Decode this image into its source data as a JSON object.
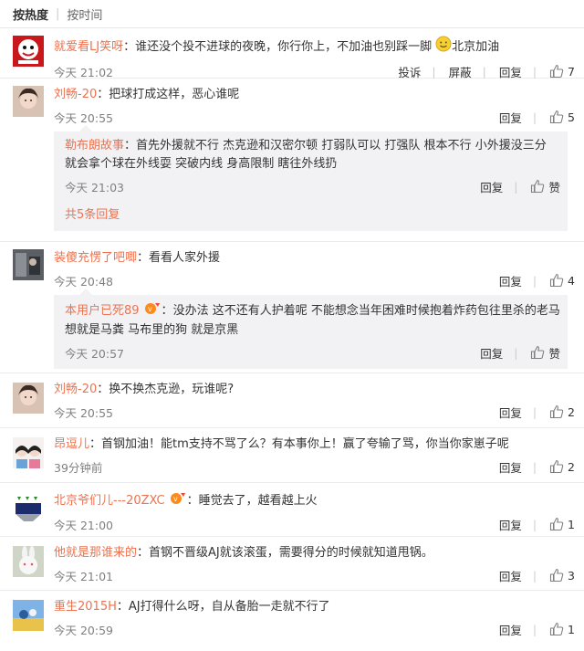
{
  "sort": {
    "hot": "按热度",
    "time": "按时间"
  },
  "actions": {
    "report": "投诉",
    "block": "屏蔽",
    "reply": "回复",
    "like_word": "赞"
  },
  "colors": {
    "username": "#eb7350",
    "bg_sub": "#f2f2f5"
  },
  "comments": [
    {
      "user": "就爱看LJ笑呀",
      "sep": "：",
      "text_before": "谁还没个投不进球的夜晚，你行你上，不加油也别踩一脚",
      "emoji": "smile-emoji",
      "text_after": "北京加油",
      "time": "今天 21:02",
      "likes": "7"
    },
    {
      "user": "刘畅-20",
      "sep": "：",
      "text": "把球打成这样，恶心谁呢",
      "time": "今天 20:55",
      "likes": "5",
      "reply": {
        "user": "勒布朗故事",
        "sep": "：",
        "text": "首先外援就不行 杰克逊和汉密尔顿 打弱队可以 打强队 根本不行 小外援没三分 就会拿个球在外线耍 突破内线 身高限制 瞎往外线扔",
        "time": "今天 21:03"
      },
      "more": "共5条回复"
    },
    {
      "user": "装傻充愣了吧唧",
      "sep": "：",
      "text": "看看人家外援",
      "time": "今天 20:48",
      "likes": "4",
      "reply": {
        "user": "本用户已死89",
        "sep": "：",
        "text": "没办法 这不还有人护着呢 不能想念当年困难时候抱着炸药包往里杀的老马 想就是马粪 马布里的狗 就是京黑",
        "time": "今天 20:57"
      }
    },
    {
      "user": "刘畅-20",
      "sep": "：",
      "text": "换不换杰克逊，玩谁呢?",
      "time": "今天 20:55",
      "likes": "2"
    },
    {
      "user": "昂逗儿",
      "sep": "：",
      "text": "首钢加油！能tm支持不骂了么？有本事你上！赢了夸输了骂，你当你家崽子呢",
      "time": "39分钟前",
      "likes": "2"
    },
    {
      "user": "北京爷们儿---20ZXC",
      "sep": "：",
      "text": "睡觉去了，越看越上火",
      "time": "今天 21:00",
      "likes": "1"
    },
    {
      "user": "他就是那谁来的",
      "sep": "：",
      "text": "首钢不晋级AJ就该滚蛋，需要得分的时候就知道甩锅。",
      "time": "今天 21:01",
      "likes": "3"
    },
    {
      "user": "重生2015H",
      "sep": "：",
      "text": "AJ打得什么呀，自从备胎一走就不行了",
      "time": "今天 20:59",
      "likes": "1"
    }
  ]
}
